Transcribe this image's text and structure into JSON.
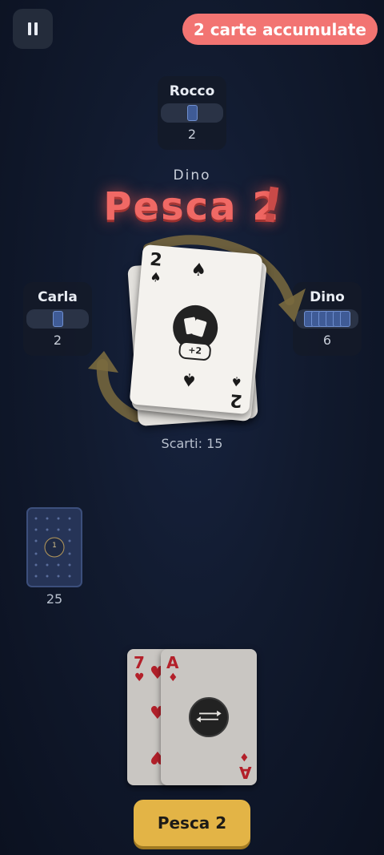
{
  "hud": {
    "pause_icon": "pause-icon",
    "stack_badge": "2 carte accumulate"
  },
  "opponents": {
    "top": {
      "name": "Rocco",
      "count": "2"
    },
    "left": {
      "name": "Carla",
      "count": "2"
    },
    "right": {
      "name": "Dino",
      "count": "6"
    }
  },
  "turn": {
    "player": "Dino",
    "action": "Pesca 2",
    "exclamation": "!"
  },
  "discard": {
    "top_card": {
      "rank": "2",
      "suit": "♠",
      "badge": "+2"
    },
    "label": "Scarti: 15"
  },
  "deck": {
    "count": "25",
    "marker": "1"
  },
  "hand": {
    "cards": [
      {
        "rank": "7",
        "suit": "♥"
      },
      {
        "rank": "A",
        "suit": "♦"
      }
    ]
  },
  "actions": {
    "draw_label": "Pesca 2"
  },
  "colors": {
    "accent_red": "#f27472",
    "button_gold": "#e3b446",
    "card_back_blue": "#263457"
  }
}
